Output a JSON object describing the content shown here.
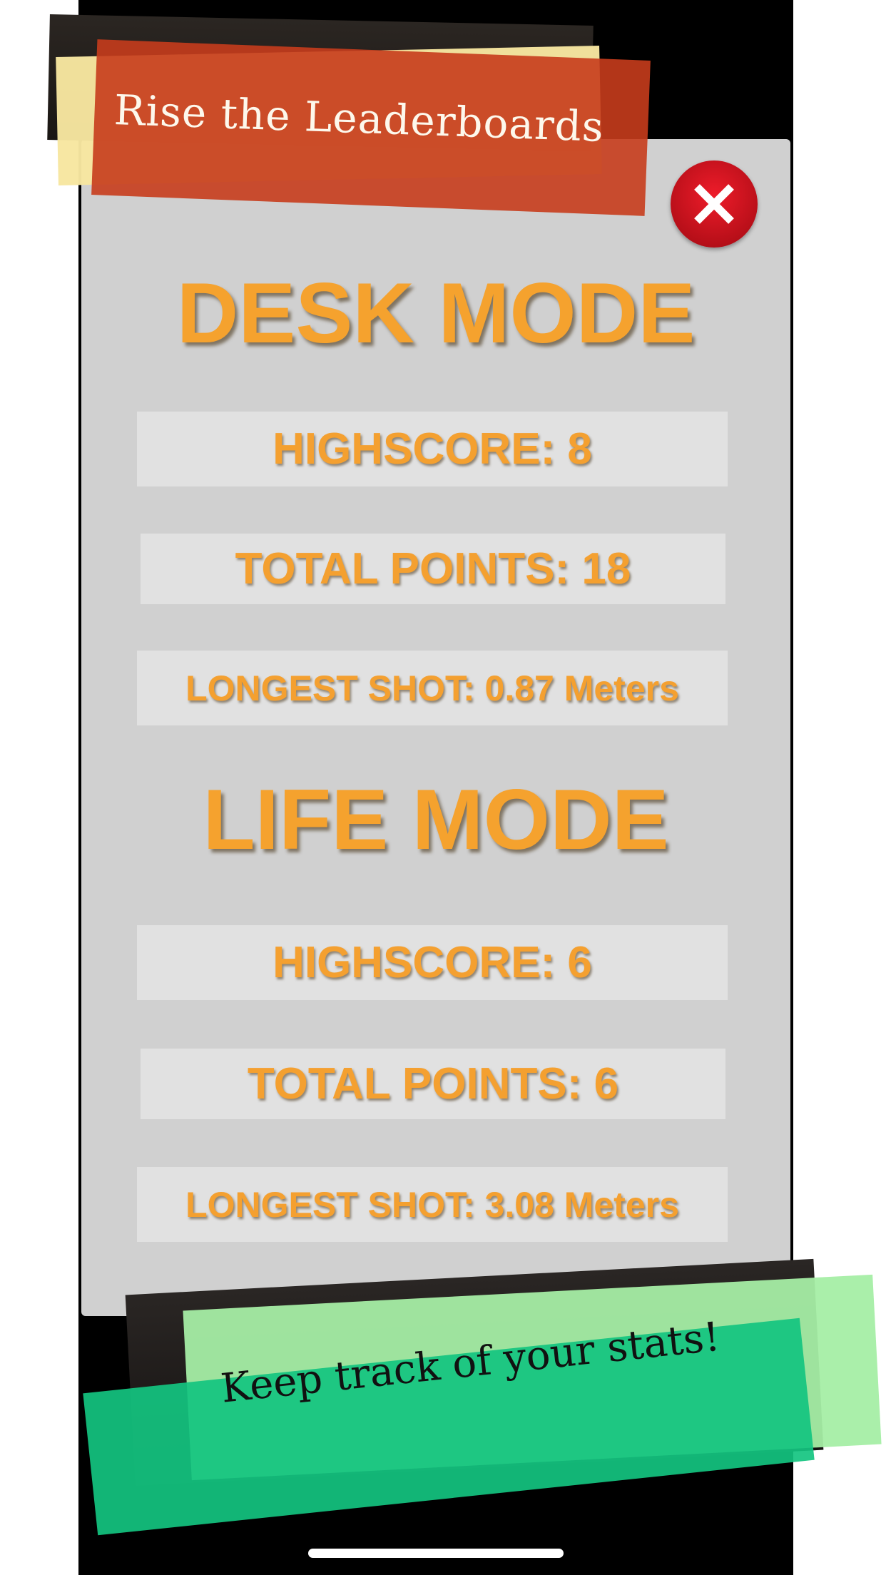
{
  "header": {
    "title": "Rise the Leaderboards"
  },
  "close_button": {
    "icon": "close-icon"
  },
  "desk_mode": {
    "title": "DESK MODE",
    "highscore": "HIGHSCORE: 8",
    "total_points": "TOTAL POINTS: 18",
    "longest_shot": "LONGEST SHOT: 0.87 Meters"
  },
  "life_mode": {
    "title": "LIFE MODE",
    "highscore": "HIGHSCORE: 6",
    "total_points": "TOTAL POINTS: 6",
    "longest_shot": "LONGEST SHOT: 3.08 Meters"
  },
  "footer": {
    "caption": "Keep track of your stats!"
  },
  "colors": {
    "accent": "#f5a22e",
    "panel": "#d0d0d0",
    "close": "#d8141f",
    "tape_red": "#c63c1c",
    "tape_green": "#14c480"
  }
}
